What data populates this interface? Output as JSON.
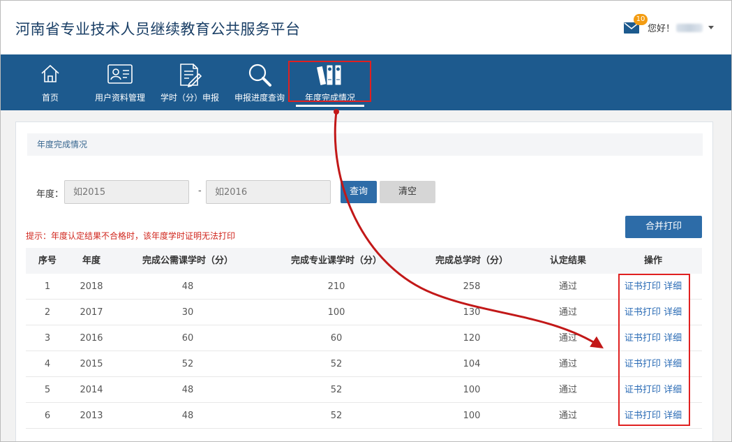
{
  "header": {
    "site_title": "河南省专业技术人员继续教育公共服务平台",
    "message_count": "10",
    "greeting": "您好！"
  },
  "nav": {
    "items": [
      {
        "label": "首页",
        "icon": "home-icon"
      },
      {
        "label": "用户资料管理",
        "icon": "id-card-icon"
      },
      {
        "label": "学时（分）申报",
        "icon": "document-pen-icon"
      },
      {
        "label": "申报进度查询",
        "icon": "magnifier-icon"
      },
      {
        "label": "年度完成情况",
        "icon": "binders-icon"
      }
    ],
    "active": "年度完成情况"
  },
  "panel": {
    "title": "年度完成情况"
  },
  "filter": {
    "label": "年度：",
    "start_placeholder": "如2015",
    "separator": "-",
    "end_placeholder": "如2016",
    "query_label": "查询",
    "clear_label": "清空"
  },
  "merge_print_label": "合并打印",
  "tip": "提示：年度认定结果不合格时，该年度学时证明无法打印",
  "table": {
    "headers": [
      "序号",
      "年度",
      "完成公需课学时（分）",
      "完成专业课学时（分）",
      "完成总学时（分）",
      "认定结果",
      "操作"
    ],
    "rows": [
      {
        "no": "1",
        "year": "2018",
        "public": "48",
        "professional": "210",
        "total": "258",
        "result": "通过",
        "print": "证书打印",
        "detail": "详细"
      },
      {
        "no": "2",
        "year": "2017",
        "public": "30",
        "professional": "100",
        "total": "130",
        "result": "通过",
        "print": "证书打印",
        "detail": "详细"
      },
      {
        "no": "3",
        "year": "2016",
        "public": "60",
        "professional": "60",
        "total": "120",
        "result": "通过",
        "print": "证书打印",
        "detail": "详细"
      },
      {
        "no": "4",
        "year": "2015",
        "public": "52",
        "professional": "52",
        "total": "104",
        "result": "通过",
        "print": "证书打印",
        "detail": "详细"
      },
      {
        "no": "5",
        "year": "2014",
        "public": "48",
        "professional": "52",
        "total": "100",
        "result": "通过",
        "print": "证书打印",
        "detail": "详细"
      },
      {
        "no": "6",
        "year": "2013",
        "public": "48",
        "professional": "52",
        "total": "100",
        "result": "通过",
        "print": "证书打印",
        "detail": "详细"
      }
    ]
  },
  "colors": {
    "nav_bg": "#1d5a8e",
    "primary_button": "#2d6ca8",
    "annotation_red": "#e02020",
    "tip_red": "#d0261d",
    "link_blue": "#2a6bb5"
  }
}
